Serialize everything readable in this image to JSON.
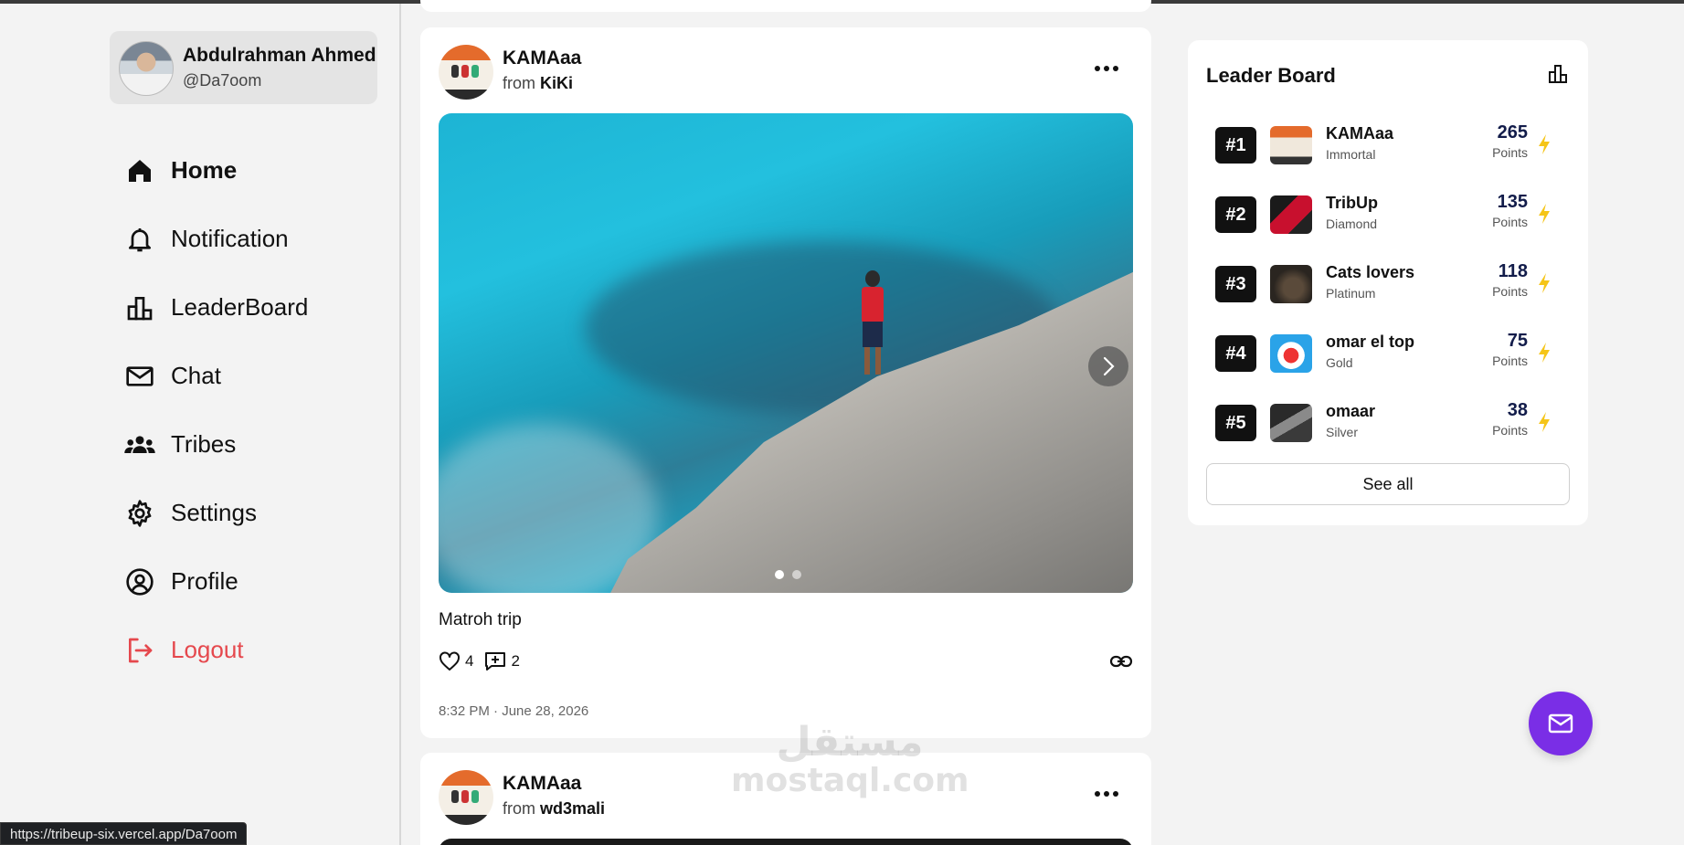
{
  "user": {
    "name": "Abdulrahman Ahmed",
    "handle": "@Da7oom"
  },
  "nav": [
    {
      "label": "Home",
      "icon": "home-icon",
      "active": true
    },
    {
      "label": "Notification",
      "icon": "bell-icon"
    },
    {
      "label": "LeaderBoard",
      "icon": "leaderboard-icon"
    },
    {
      "label": "Chat",
      "icon": "mail-icon"
    },
    {
      "label": "Tribes",
      "icon": "group-icon"
    },
    {
      "label": "Settings",
      "icon": "gear-icon"
    },
    {
      "label": "Profile",
      "icon": "user-circle-icon"
    },
    {
      "label": "Logout",
      "icon": "logout-icon",
      "color": "#e5484d"
    }
  ],
  "posts": [
    {
      "author": "KAMAaa",
      "from_prefix": "from",
      "tribe": "KiKi",
      "caption": "Matroh trip",
      "likes": "4",
      "comments": "2",
      "time": "8:32 PM · June 28, 2026",
      "image_count": 2,
      "active_image": 1
    },
    {
      "author": "KAMAaa",
      "from_prefix": "from",
      "tribe": "wd3mali"
    }
  ],
  "leaderboard": {
    "title": "Leader Board",
    "points_label": "Points",
    "see_all": "See all",
    "accent": "#f5c518",
    "rows": [
      {
        "rank": "#1",
        "name": "KAMAaa",
        "tier": "Immortal",
        "points": "265"
      },
      {
        "rank": "#2",
        "name": "TribUp",
        "tier": "Diamond",
        "points": "135"
      },
      {
        "rank": "#3",
        "name": "Cats lovers",
        "tier": "Platinum",
        "points": "118"
      },
      {
        "rank": "#4",
        "name": "omar el top",
        "tier": "Gold",
        "points": "75"
      },
      {
        "rank": "#5",
        "name": "omaar",
        "tier": "Silver",
        "points": "38"
      }
    ]
  },
  "fab": {
    "icon": "mail-icon",
    "color": "#7a2ee6"
  },
  "status_url": "https://tribeup-six.vercel.app/Da7oom",
  "watermark": {
    "line1": "مستقل",
    "line2": "mostaql.com"
  }
}
